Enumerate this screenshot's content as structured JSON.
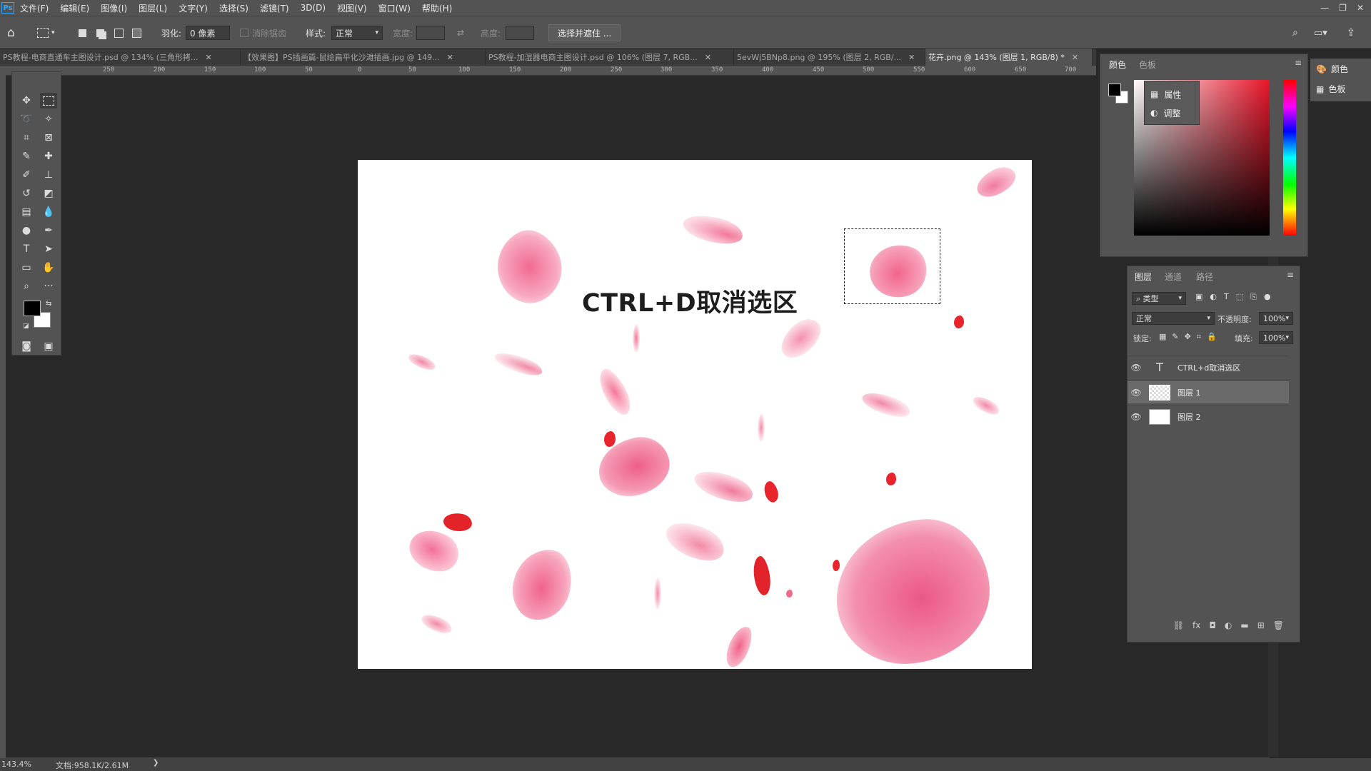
{
  "menu": [
    "文件(F)",
    "编辑(E)",
    "图像(I)",
    "图层(L)",
    "文字(Y)",
    "选择(S)",
    "滤镜(T)",
    "3D(D)",
    "视图(V)",
    "窗口(W)",
    "帮助(H)"
  ],
  "options": {
    "feather_label": "羽化:",
    "feather_value": "0 像素",
    "antialias_label": "消除锯齿",
    "style_label": "样式:",
    "style_value": "正常",
    "width_label": "宽度:",
    "height_label": "高度:",
    "select_mask_button": "选择并遮住 ..."
  },
  "tabs": [
    {
      "label": "PS教程-电商直通车主图设计.psd @ 134% (三角形拷..."
    },
    {
      "label": "【效果图】PS插画篇-鼠绘扁平化沙滩插画.jpg @ 149..."
    },
    {
      "label": "PS教程-加湿器电商主图设计.psd @ 106% (图层 7, RGB..."
    },
    {
      "label": "5evWj5BNp8.png @ 195% (图层 2, RGB/..."
    },
    {
      "label": "花卉.png @ 143% (图层 1, RGB/8) *"
    }
  ],
  "ruler_ticks": [
    "250",
    "200",
    "150",
    "100",
    "50",
    "0",
    "50",
    "100",
    "150",
    "200",
    "250",
    "300",
    "350",
    "400",
    "450",
    "500",
    "550",
    "600",
    "650",
    "700"
  ],
  "canvas": {
    "text": "CTRL+D取消选区"
  },
  "status": {
    "zoom": "143.4%",
    "doc": "文档:958.1K/2.61M"
  },
  "color_panel": {
    "tabs": [
      "颜色",
      "色板"
    ],
    "flyout": [
      "属性",
      "调整"
    ]
  },
  "right_dock": [
    "颜色",
    "色板"
  ],
  "layers_panel": {
    "tabs": [
      "图层",
      "通道",
      "路径"
    ],
    "filter_kind": "类型",
    "blend_mode": "正常",
    "opacity_label": "不透明度:",
    "opacity_value": "100%",
    "lock_label": "锁定:",
    "fill_label": "填充:",
    "fill_value": "100%",
    "layers": [
      {
        "name": "CTRL+d取消选区"
      },
      {
        "name": "图层 1"
      },
      {
        "name": "图层 2"
      }
    ]
  },
  "colors": {
    "accent": "#31a8ff",
    "panel_bg": "#535353",
    "workspace_bg": "#282828"
  }
}
